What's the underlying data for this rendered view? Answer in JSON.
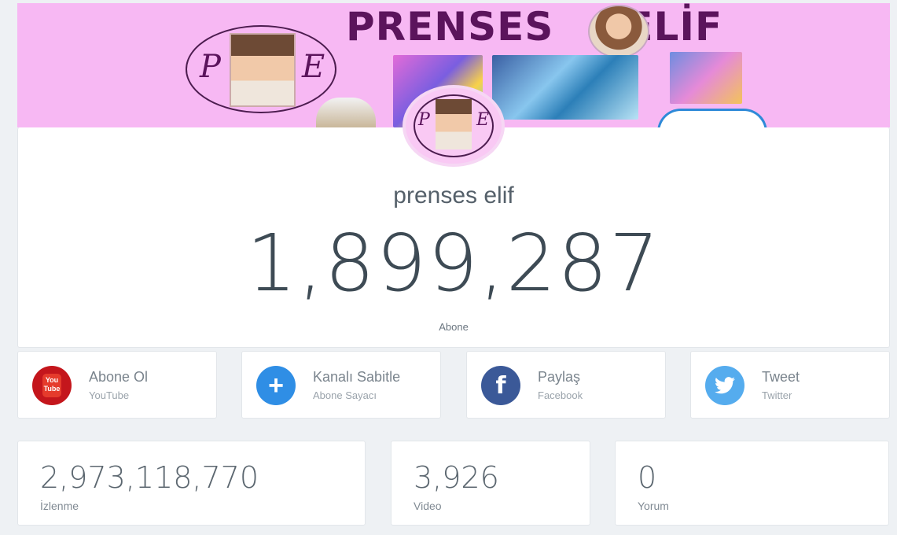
{
  "banner": {
    "title_left": "PRENSES",
    "title_right": "ELİF",
    "logo_letter_left": "P",
    "logo_letter_right": "E",
    "background": "#f7b8f3"
  },
  "channel": {
    "name": "prenses elif",
    "subscribers": "1,899,287",
    "subscribers_label": "Abone"
  },
  "actions": [
    {
      "label": "Abone Ol",
      "sub": "YouTube",
      "icon": "youtube-icon",
      "color": "#c4161c",
      "glyph": "You Tube"
    },
    {
      "label": "Kanalı Sabitle",
      "sub": "Abone Sayacı",
      "icon": "plus-icon",
      "color": "#2f8ee5",
      "glyph": "+"
    },
    {
      "label": "Paylaş",
      "sub": "Facebook",
      "icon": "facebook-icon",
      "color": "#3b5998",
      "glyph": "f"
    },
    {
      "label": "Tweet",
      "sub": "Twitter",
      "icon": "twitter-icon",
      "color": "#55acee",
      "glyph": "🐦"
    }
  ],
  "stats": [
    {
      "value": "2,973,118,770",
      "label": "İzlenme"
    },
    {
      "value": "3,926",
      "label": "Video"
    },
    {
      "value": "0",
      "label": "Yorum"
    }
  ]
}
